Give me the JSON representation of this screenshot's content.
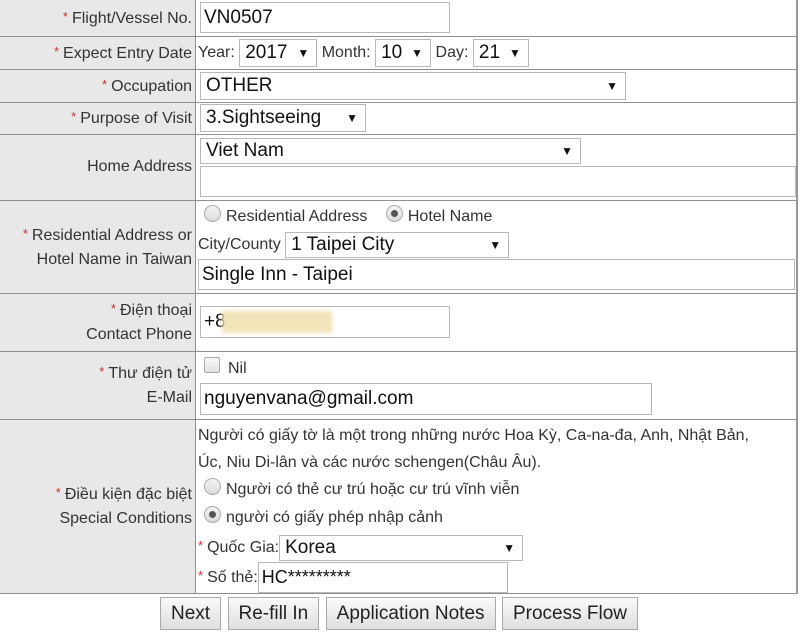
{
  "fields": {
    "flight": {
      "label": "Flight/Vessel No.",
      "value": "VN0507"
    },
    "entry_date": {
      "label": "Expect Entry Date",
      "year_label": "Year:",
      "year": "2017",
      "month_label": "Month:",
      "month": "10",
      "day_label": "Day:",
      "day": "21"
    },
    "occupation": {
      "label": "Occupation",
      "value": "OTHER"
    },
    "purpose": {
      "label": "Purpose of Visit",
      "value": "3.Sightseeing"
    },
    "home_address": {
      "label": "Home Address",
      "country": "Viet Nam",
      "address": ""
    },
    "residential": {
      "label_line1": "Residential Address or",
      "label_line2": "Hotel Name in Taiwan",
      "option_residential": "Residential Address",
      "option_hotel": "Hotel Name",
      "selected": "Hotel Name",
      "city_label": "City/County",
      "city": "1 Taipei City",
      "hotel": "Single Inn - Taipei"
    },
    "phone": {
      "label_line1": "Điện thoại",
      "label_line2": "Contact Phone",
      "value": "+8"
    },
    "email": {
      "label_line1": "Thư điện tử",
      "label_line2": "E-Mail",
      "nil_label": "Nil",
      "nil_checked": false,
      "value": "nguyenvana@gmail.com"
    },
    "special": {
      "label_line1": "Điều kiện đặc biệt",
      "label_line2": "Special Conditions",
      "description": "Người có giấy tờ là một trong những nước Hoa Kỳ, Ca-na-đa, Anh, Nhật Bản, Úc, Niu Di-lân và các nước schengen(Châu Âu).",
      "option_permanent": "Người có thẻ cư trú hoặc cư trú vĩnh viễn",
      "option_permit": "người có giấy phép nhập cảnh",
      "selected": "người có giấy phép nhập cảnh",
      "country_label": "Quốc Gia:",
      "country": "Korea",
      "card_label": "Số thẻ:",
      "card": "HC*********"
    }
  },
  "buttons": {
    "next": "Next",
    "refill": "Re-fill In",
    "notes": "Application Notes",
    "flow": "Process Flow"
  },
  "required_marker": "*",
  "icons": {
    "dropdown": "▼"
  }
}
